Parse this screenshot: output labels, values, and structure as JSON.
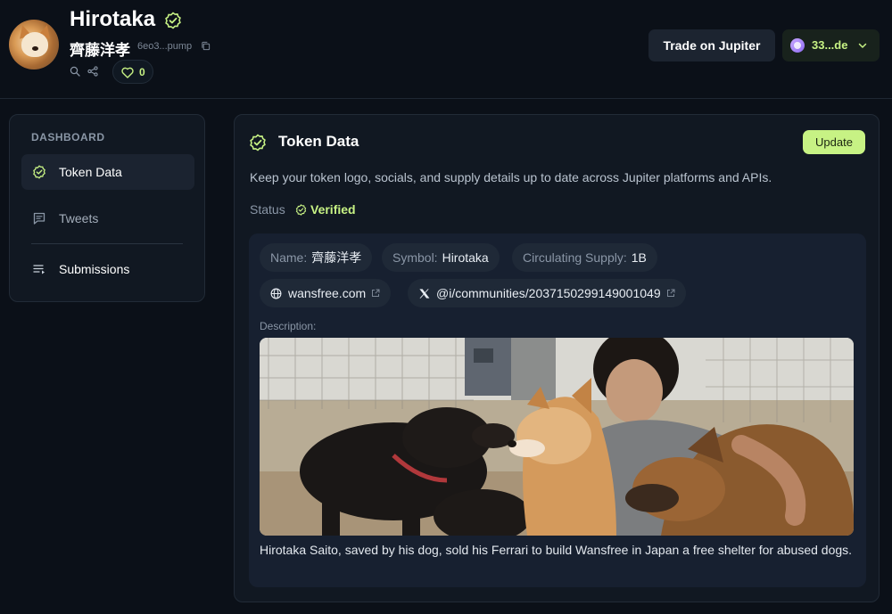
{
  "header": {
    "token_name": "Hirotaka",
    "token_subname": "齊藤洋孝",
    "address": "6eo3...pump",
    "likes": "0",
    "trade_label": "Trade on Jupiter",
    "wallet_label": "33...de"
  },
  "sidebar": {
    "heading": "DASHBOARD",
    "items": [
      {
        "label": "Token Data",
        "icon": "check-badge-icon",
        "active": true
      },
      {
        "label": "Tweets",
        "icon": "message-icon",
        "active": false
      },
      {
        "label": "Submissions",
        "icon": "list-icon",
        "active": false
      }
    ]
  },
  "card": {
    "title": "Token Data",
    "update_label": "Update",
    "description": "Keep your token logo, socials, and supply details up to date across Jupiter platforms and APIs.",
    "status_label": "Status",
    "status_value": "Verified",
    "fields": {
      "name_key": "Name:",
      "name_value": "齊藤洋孝",
      "symbol_key": "Symbol:",
      "symbol_value": "Hirotaka",
      "supply_key": "Circulating Supply:",
      "supply_value": "1B"
    },
    "links": {
      "website": "wansfree.com",
      "twitter": "@i/communities/2037150299149001049"
    },
    "description_label": "Description:",
    "description_text": "Hirotaka Saito, saved by his dog, sold his Ferrari to build Wansfree in Japan a free shelter for abused dogs."
  },
  "colors": {
    "background": "#0b1018",
    "card": "#111822",
    "accent": "#c7f284",
    "muted": "#8a96a6"
  }
}
